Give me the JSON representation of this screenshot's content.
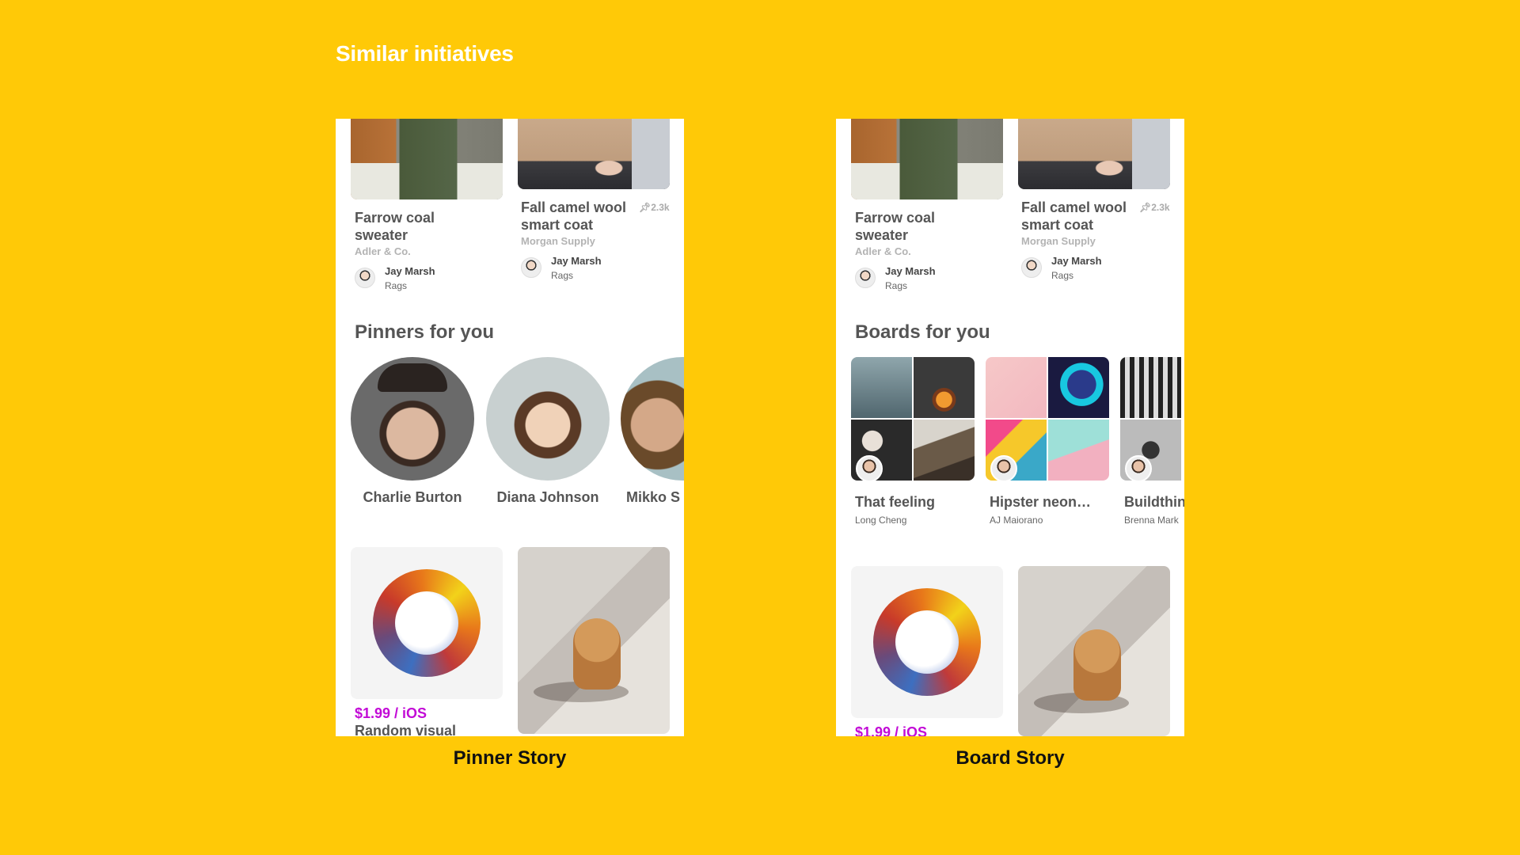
{
  "page_title": "Similar initiatives",
  "captions": {
    "left": "Pinner Story",
    "right": "Board Story"
  },
  "pins": [
    {
      "title_line1": "Farrow coal",
      "title_line2": "sweater",
      "source": "Adler & Co.",
      "user": "Jay Marsh",
      "board": "Rags"
    },
    {
      "title_line1": "Fall camel wool",
      "title_line2": "smart coat",
      "source": "Morgan Supply",
      "count": "2.3k",
      "user": "Jay Marsh",
      "board": "Rags"
    }
  ],
  "pinner_story": {
    "section_title": "Pinners for you",
    "pinners": [
      "Charlie Burton",
      "Diana Johnson",
      "Mikko S"
    ]
  },
  "board_story": {
    "section_title": "Boards for you",
    "boards": [
      {
        "name": "That feeling",
        "owner": "Long Cheng"
      },
      {
        "name": "Hipster neon…",
        "owner": "AJ Maiorano"
      },
      {
        "name": "Buildthin",
        "owner": "Brenna Mark"
      }
    ]
  },
  "app_promo": {
    "price": "$1.99 / iOS",
    "title": "Random visual"
  },
  "colors": {
    "background": "#FFC907",
    "price": "#C20BD6"
  }
}
